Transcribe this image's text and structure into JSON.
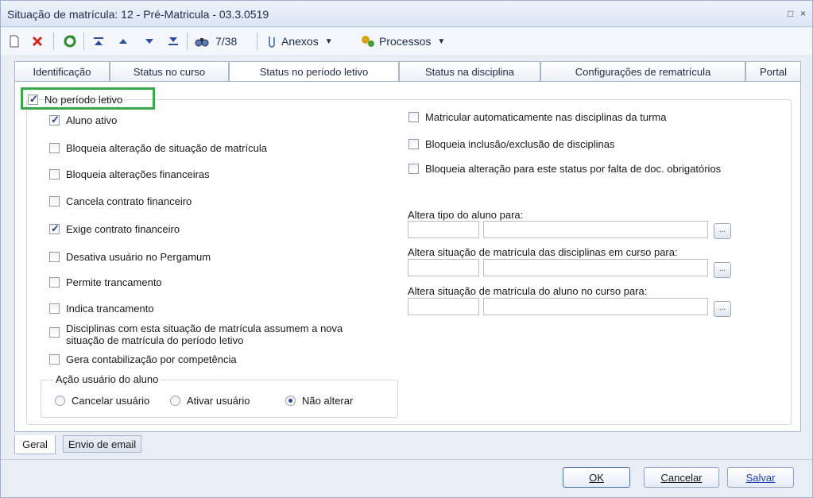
{
  "window": {
    "title": "Situação de matrícula: 12 - Pré-Matricula - 03.3.0519",
    "controls": [
      "□",
      "×"
    ]
  },
  "toolbar": {
    "record_pos": "7/38",
    "attachments": "Anexos",
    "processes": "Processos",
    "icons": [
      "new-icon",
      "delete-icon",
      "refresh-icon",
      "first-icon",
      "prev-icon",
      "next-icon",
      "last-icon",
      "find-icon"
    ]
  },
  "tabs": [
    "Identificação",
    "Status no curso",
    "Status no período letivo",
    "Status na disciplina",
    "Configurações de rematrícula",
    "Portal"
  ],
  "panel": {
    "group_title": "No período letivo",
    "group_checked": true,
    "left_checks": [
      {
        "label": "Aluno ativo",
        "checked": true
      },
      {
        "label": "Bloqueia alteração de situação de matrícula",
        "checked": false
      },
      {
        "label": "Bloqueia alterações financeiras",
        "checked": false
      },
      {
        "label": "Cancela contrato financeiro",
        "checked": false
      },
      {
        "label": "Exige contrato financeiro",
        "checked": true
      },
      {
        "label": "Desativa usuário no Pergamum",
        "checked": false
      },
      {
        "label": "Permite trancamento",
        "checked": false
      },
      {
        "label": "Indica trancamento",
        "checked": false
      },
      {
        "label": "Disciplinas com esta situação de matrícula assumem a nova",
        "label2": "situação de matrícula do período letivo",
        "checked": false
      },
      {
        "label": "Gera contabilização por competência",
        "checked": false
      }
    ],
    "right_checks": [
      {
        "label": "Matricular automaticamente nas disciplinas da turma",
        "checked": false
      },
      {
        "label": "Bloqueia inclusão/exclusão de disciplinas",
        "checked": false
      },
      {
        "label": "Bloqueia alteração para este status por falta de doc. obrigatórios",
        "checked": false
      }
    ],
    "fields": [
      {
        "label": "Altera tipo do aluno para:",
        "code": "",
        "desc": ""
      },
      {
        "label": "Altera situação de matrícula das disciplinas em curso para:",
        "code": "",
        "desc": ""
      },
      {
        "label": "Altera situação de matrícula do aluno no curso para:",
        "code": "",
        "desc": ""
      }
    ],
    "lookup_label": "...",
    "user_action": {
      "title": "Ação usuário do aluno",
      "options": [
        "Cancelar usuário",
        "Ativar usuário",
        "Não alterar"
      ],
      "selected": "Não alterar"
    }
  },
  "bottom_tabs": [
    "Geral",
    "Envio de email"
  ],
  "footer": {
    "ok": "OK",
    "cancel": "Cancelar",
    "save": "Salvar"
  },
  "colors": {
    "highlight": "#3aa84a",
    "title_bg": "#dbe5f3"
  }
}
